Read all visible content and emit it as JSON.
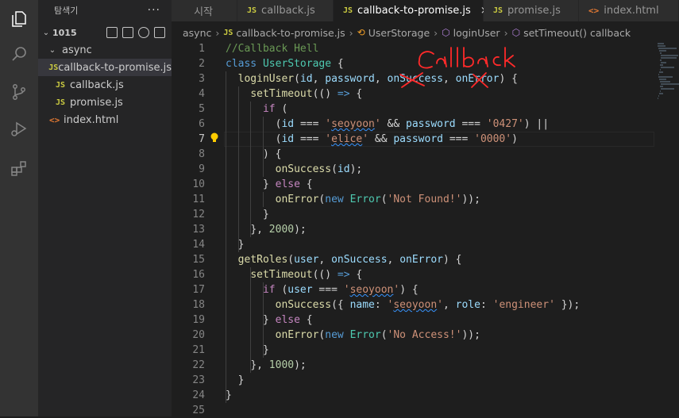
{
  "sidebar": {
    "title": "탐색기",
    "more": "···",
    "root": "1015",
    "folder": "async",
    "files": [
      {
        "icon": "JS",
        "label": "callback-to-promise.js"
      },
      {
        "icon": "JS",
        "label": "callback.js"
      },
      {
        "icon": "JS",
        "label": "promise.js"
      }
    ],
    "root_file": {
      "icon": "<>",
      "label": "index.html"
    }
  },
  "tabs": [
    {
      "label": "시작",
      "icon": ""
    },
    {
      "label": "callback.js",
      "icon": "JS"
    },
    {
      "label": "callback-to-promise.js",
      "icon": "JS",
      "close": "×"
    },
    {
      "label": "promise.js",
      "icon": "JS"
    },
    {
      "label": "index.html",
      "icon": "<>"
    }
  ],
  "breadcrumb": {
    "items": [
      "async",
      "callback-to-promise.js",
      "UserStorage",
      "loginUser",
      "setTimeout() callback"
    ],
    "icons": [
      "",
      "JS",
      "class-icon",
      "method-icon",
      "method-icon"
    ]
  },
  "editor": {
    "current_line": 7,
    "line_numbers": [
      "1",
      "2",
      "3",
      "4",
      "5",
      "6",
      "7",
      "8",
      "9",
      "10",
      "11",
      "12",
      "13",
      "14",
      "15",
      "16",
      "17",
      "18",
      "19",
      "20",
      "21",
      "22",
      "23",
      "24",
      "25"
    ],
    "lines": [
      "//Callback Hell",
      "class UserStorage {",
      "  loginUser(id, password, onSuccess, onError) {",
      "    setTimeout(() => {",
      "      if (",
      "        (id === 'seoyoon' && password === '0427') ||",
      "        (id === 'elice' && password === '0000')",
      "      ) {",
      "        onSuccess(id);",
      "      } else {",
      "        onError(new Error('Not Found!'));",
      "      }",
      "    }, 2000);",
      "  }",
      "  getRoles(user, onSuccess, onError) {",
      "    setTimeout(() => {",
      "      if (user === 'seoyoon') {",
      "        onSuccess({ name: 'seoyoon', role: 'engineer' });",
      "      } else {",
      "        onError(new Error('No Access!'));",
      "      }",
      "    }, 1000);",
      "  }",
      "}",
      ""
    ]
  },
  "annotation": {
    "text": "Callback",
    "color": "#ff2020"
  }
}
